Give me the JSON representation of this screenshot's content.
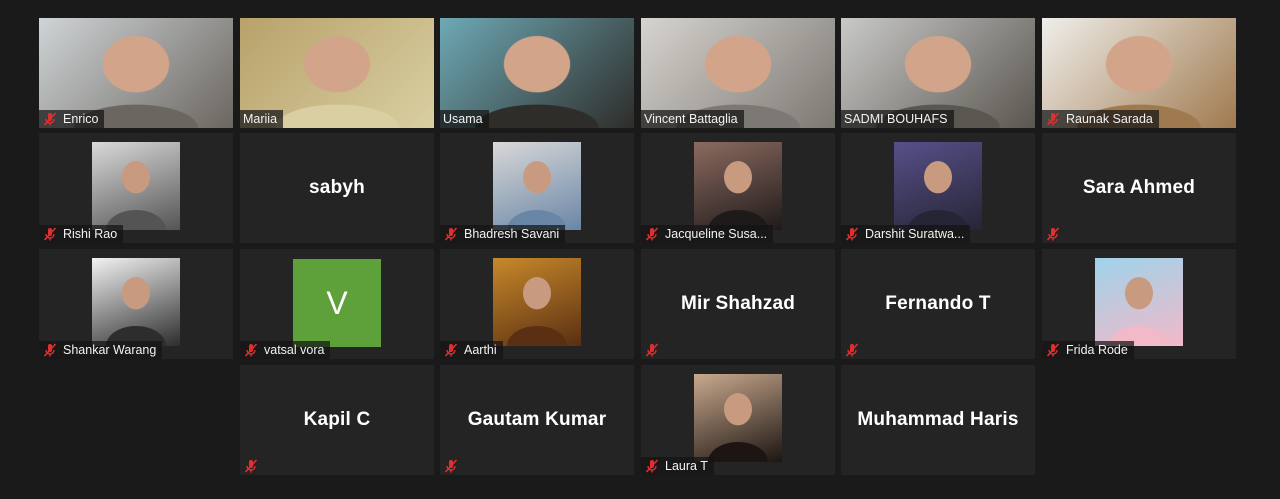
{
  "participants": [
    {
      "name": "Enrico",
      "type": "video",
      "muted": true,
      "bg": [
        "#cfd4d6",
        "#6b6660"
      ]
    },
    {
      "name": "Mariia",
      "type": "video",
      "muted": false,
      "active": true,
      "bg": [
        "#b8a26a",
        "#d9cfa2"
      ]
    },
    {
      "name": "Usama",
      "type": "video",
      "muted": false,
      "bg": [
        "#6ea9b5",
        "#2e2d2a"
      ]
    },
    {
      "name": "Vincent Battaglia",
      "type": "video",
      "muted": false,
      "bg": [
        "#d7d4cf",
        "#7c7873"
      ]
    },
    {
      "name": "SADMI BOUHAFS",
      "type": "video",
      "muted": false,
      "bg": [
        "#c9c9c7",
        "#5a5650"
      ]
    },
    {
      "name": "Raunak Sarada",
      "type": "video",
      "muted": true,
      "bg": [
        "#efeeea",
        "#a07a4f"
      ]
    },
    {
      "name": "Rishi Rao",
      "type": "photo",
      "muted": true,
      "bg": [
        "#d9d9d9",
        "#545454"
      ]
    },
    {
      "name": "sabyh",
      "type": "text",
      "muted": false
    },
    {
      "name": "Bhadresh Savani",
      "type": "photo",
      "muted": true,
      "bg": [
        "#d8d8d8",
        "#6a86a6"
      ]
    },
    {
      "name": "Jacqueline Susa...",
      "type": "photo",
      "muted": true,
      "bg": [
        "#8b6b60",
        "#1f1a1a"
      ]
    },
    {
      "name": "Darshit Suratwa...",
      "type": "photo",
      "muted": true,
      "bg": [
        "#57508a",
        "#262535"
      ]
    },
    {
      "name": "Sara Ahmed",
      "type": "text",
      "muted": true
    },
    {
      "name": "Shankar Warang",
      "type": "photo",
      "muted": true,
      "bg": [
        "#f2f2f2",
        "#2d2d2d"
      ]
    },
    {
      "name": "vatsal vora",
      "type": "initial",
      "initial": "V",
      "muted": true
    },
    {
      "name": "Aarthi",
      "type": "photo",
      "muted": true,
      "bg": [
        "#c7892a",
        "#5a2f12"
      ]
    },
    {
      "name": "Mir Shahzad",
      "type": "text",
      "muted": true
    },
    {
      "name": "Fernando T",
      "type": "text",
      "muted": true
    },
    {
      "name": "Frida Rode",
      "type": "photo",
      "muted": true,
      "bg": [
        "#9fd3ea",
        "#f2b9c8"
      ]
    },
    {
      "name": "Kapil C",
      "type": "text",
      "muted": true
    },
    {
      "name": "Gautam Kumar",
      "type": "text",
      "muted": true
    },
    {
      "name": "Laura T",
      "type": "photo",
      "muted": true,
      "bg": [
        "#c9a98e",
        "#1c1512"
      ]
    },
    {
      "name": "Muhammad Haris",
      "type": "text",
      "muted": false
    }
  ],
  "colors": {
    "background": "#1a1a1a",
    "tile": "#242424",
    "active_border": "#e9e34c",
    "mute_icon": "#e02f2f",
    "avatar_initial_bg": "#5ea03a"
  },
  "icons": {
    "mute": "mic-muted-icon"
  }
}
